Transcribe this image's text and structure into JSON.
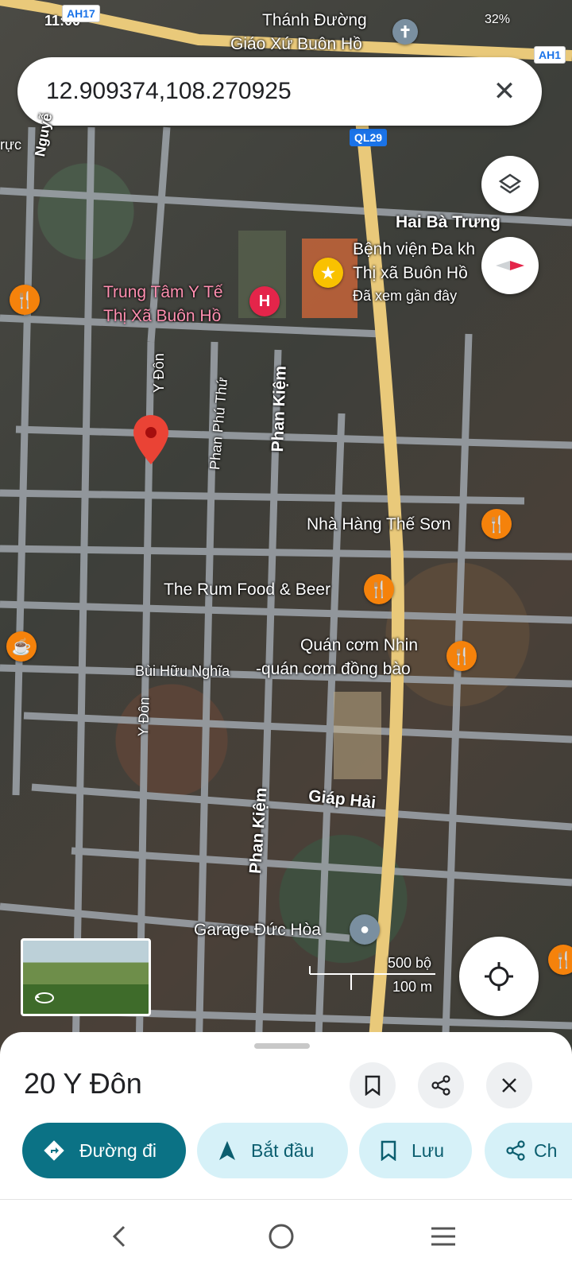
{
  "status_bar": {
    "time": "11:00",
    "battery": "32%"
  },
  "search": {
    "query": "12.909374,108.270925"
  },
  "map_labels": {
    "church_1": "Thánh Đường",
    "church_2": "Giáo Xứ Buôn Hồ",
    "route_ah17": "AH17",
    "route_ah1": "AH1",
    "route_ql29": "QL29",
    "road_nguyen": "Nguyễ",
    "road_truc": "rực",
    "road_hai_ba_trung": "Hai Bà Trưng",
    "hospital_big_1": "Bệnh viện Đa kh",
    "hospital_big_2": "Thị xã Buôn Hồ",
    "hospital_big_3": "Đã xem gần đây",
    "medical_center_1": "Trung Tâm Y Tế",
    "medical_center_2": "Thị Xã Buôn Hồ",
    "road_y_don_top": "Y Đôn",
    "road_phan_phu_thu": "Phan Phú Thứ",
    "road_phan_kiem_top": "Phan Kiệm",
    "restaurant_the_son": "Nhà Hàng Thế Sơn",
    "restaurant_rum": "The Rum Food & Beer",
    "restaurant_nhin_1": "Quán cơm Nhin",
    "restaurant_nhin_2": "-quán cơm đồng bào",
    "road_bui_huu_nghia": "Bùi Hữu Nghĩa",
    "road_y_don_bottom": "Y Đôn",
    "road_giap_hai": "Giáp Hải",
    "road_phan_kiem_bottom": "Phan Kiệm",
    "garage": "Garage Đức Hòa",
    "hospital_glyph": "H"
  },
  "scale": {
    "imperial": "500 bộ",
    "metric": "100 m"
  },
  "place": {
    "title": "20 Y Đôn",
    "actions": [
      {
        "label": "Đường đi",
        "icon": "directions-icon"
      },
      {
        "label": "Bắt đầu",
        "icon": "navigation-arrow-icon"
      },
      {
        "label": "Lưu",
        "icon": "bookmark-icon"
      },
      {
        "label": "Ch",
        "icon": "share-icon"
      }
    ]
  },
  "colors": {
    "primary_chip": "#0b7285",
    "light_chip": "#d6f1f8",
    "pin_red": "#ea4335",
    "food_pin": "#f5820b",
    "highway": "#e9c97a"
  }
}
